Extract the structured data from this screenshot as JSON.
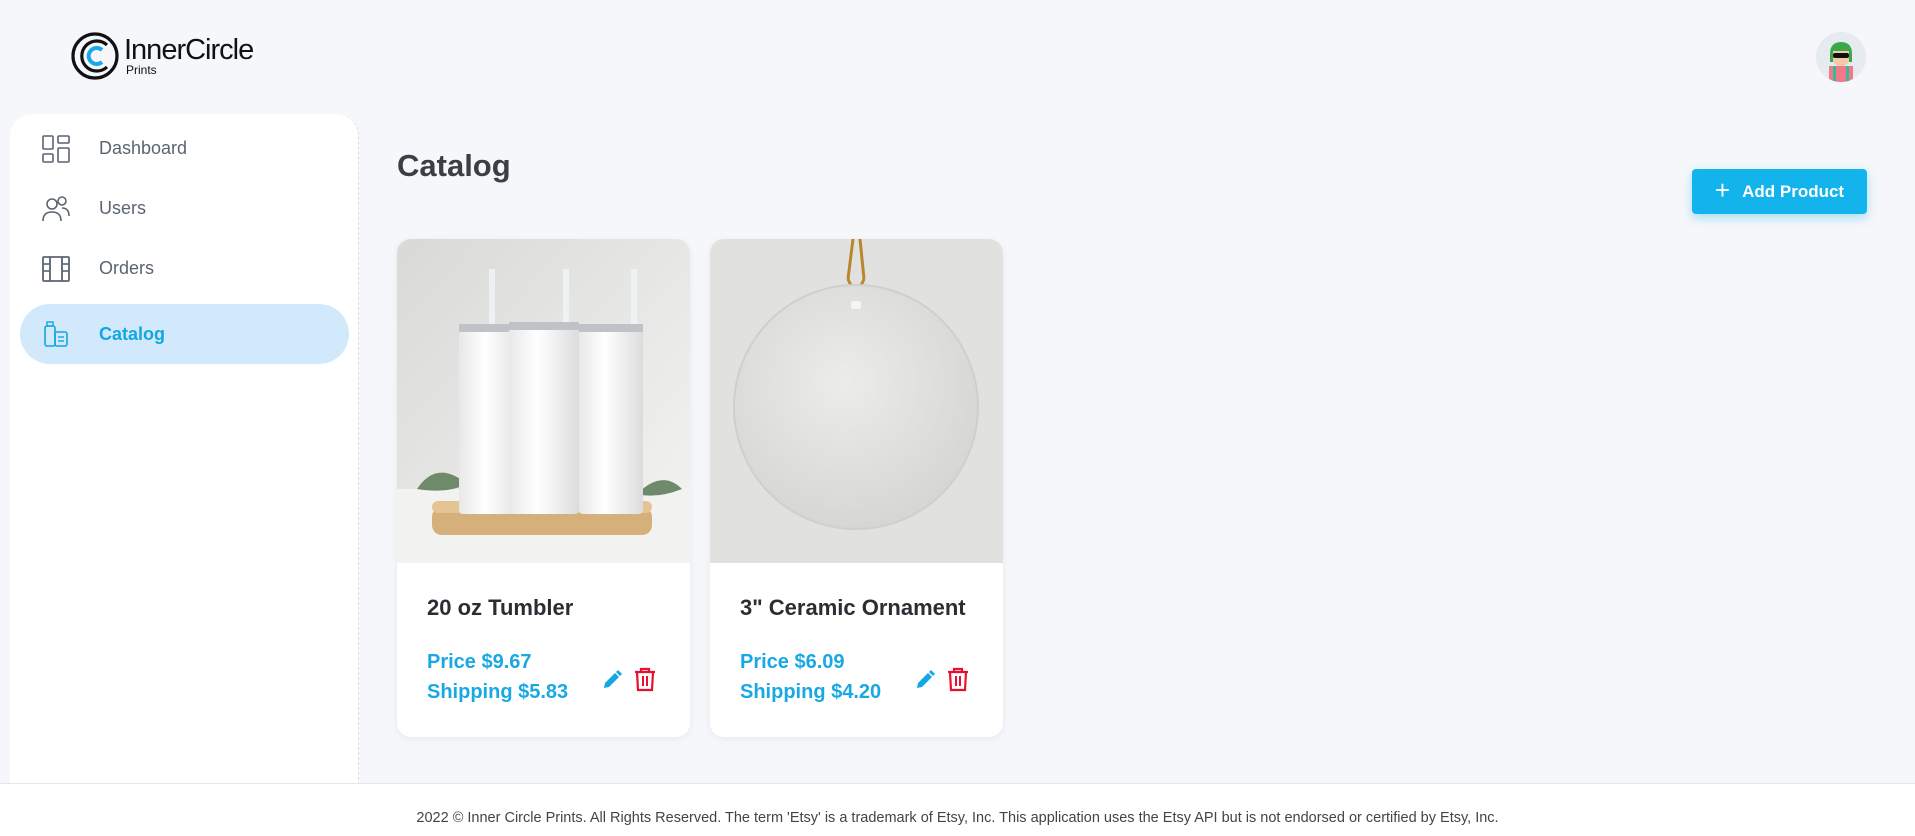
{
  "brand": {
    "name": "InnerCircle",
    "sub": "Prints"
  },
  "sidebar": {
    "items": [
      {
        "label": "Dashboard",
        "icon": "dashboard-icon"
      },
      {
        "label": "Users",
        "icon": "users-icon"
      },
      {
        "label": "Orders",
        "icon": "orders-icon"
      },
      {
        "label": "Catalog",
        "icon": "catalog-icon",
        "active": true
      }
    ]
  },
  "main": {
    "title": "Catalog",
    "add_button": "Add Product",
    "products": [
      {
        "name": "20 oz Tumbler",
        "price": "Price $9.67",
        "shipping": "Shipping $5.83"
      },
      {
        "name": "3\" Ceramic Ornament",
        "price": "Price $6.09",
        "shipping": "Shipping $4.20"
      }
    ]
  },
  "footer": {
    "text": "2022 © Inner Circle Prints. All Rights Reserved. The term 'Etsy' is a trademark of Etsy, Inc. This application uses the Etsy API but is not endorsed or certified by Etsy, Inc."
  },
  "colors": {
    "accent": "#13b3ec",
    "active_nav_bg": "#d2e9fb",
    "delete": "#e8112d"
  }
}
